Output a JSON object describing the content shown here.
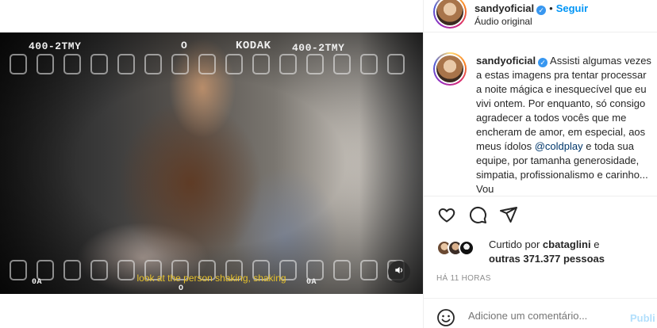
{
  "video": {
    "film_code_left": "400-2TMY",
    "film_mark_o": "O",
    "film_brand": "KODAK",
    "film_code_right": "400-2TMY",
    "subtitle": "look at the person shaking, shaking",
    "bottom_left_mark": "0A",
    "bottom_mid_mark": "O",
    "bottom_right_mark": "0A"
  },
  "header": {
    "username": "sandyoficial",
    "verified_glyph": "✓",
    "separator": "•",
    "follow_label": "Seguir",
    "audio_label": "Áudio original"
  },
  "caption": {
    "username": "sandyoficial",
    "text_before_mention": "Assisti algumas vezes a estas imagens pra tentar processar a noite mágica e inesquecível que eu vivi ontem. Por enquanto, só consigo agradecer a todos vocês que me encheram de amor, em especial, aos meus ídolos ",
    "mention": "@coldplay",
    "text_after_mention": " e toda sua equipe, por tamanha generosidade, simpatia, profissionalismo e carinho... Vou"
  },
  "likes": {
    "prefix": "Curtido por ",
    "user": "cbataglini",
    "middle": " e",
    "others": "outras 371.377 pessoas"
  },
  "timestamp": "HÁ 11 HORAS",
  "comment": {
    "placeholder": "Adicione um comentário...",
    "publish_label": "Publi"
  },
  "icons": {
    "like": "heart-icon",
    "comment": "comment-icon",
    "share": "paper-plane-icon",
    "volume": "speaker-icon",
    "emoji": "smiley-icon"
  },
  "colors": {
    "link_blue": "#0095f6",
    "mention": "#00376b",
    "verified": "#3897f0",
    "subtitle": "#e7c22a",
    "muted": "#8e8e8e"
  }
}
